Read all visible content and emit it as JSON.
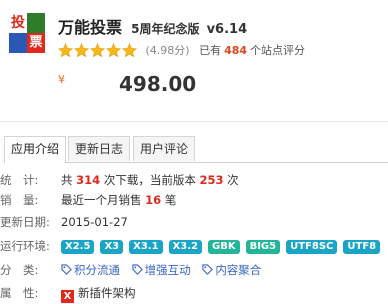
{
  "logo": {
    "text": "投票"
  },
  "header": {
    "name": "万能投票",
    "edition": "5周年纪念版",
    "version": "v6.14"
  },
  "rating": {
    "stars": 5,
    "score_text": "(4.98分)",
    "sites_prefix": "已有",
    "sites_count": "484",
    "sites_suffix": "个站点评分"
  },
  "price": {
    "symbol": "¥",
    "value": "498.00"
  },
  "tabs": [
    {
      "label": "应用介绍"
    },
    {
      "label": "更新日志"
    },
    {
      "label": "用户评论"
    }
  ],
  "info": {
    "stats": {
      "label": "统　计:",
      "prefix": "共",
      "downloads": "314",
      "mid": "次下载，当前版本",
      "current": "253",
      "suffix": "次"
    },
    "sales": {
      "label": "销　量:",
      "prefix": "最近一个月销售",
      "count": "16",
      "suffix": "笔"
    },
    "updated": {
      "label": "更新日期:",
      "value": "2015-01-27"
    },
    "env": {
      "label": "运行环境:",
      "items": [
        "X2.5",
        "X3",
        "X3.1",
        "X3.2",
        "GBK",
        "BIG5",
        "UTF8SC",
        "UTF8"
      ]
    },
    "category": {
      "label": "分　类:",
      "tags": [
        "积分流通",
        "增强互动",
        "内容聚合"
      ]
    },
    "attribute": {
      "label": "属　性:",
      "icon": "X",
      "value": "新插件架构"
    }
  }
}
